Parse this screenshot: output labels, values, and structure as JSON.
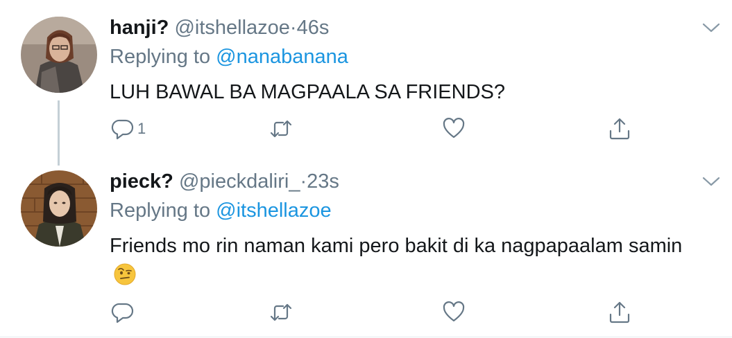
{
  "tweets": [
    {
      "name": "hanji?",
      "handle": "@itshellazoe",
      "dot": "·",
      "time": "46s",
      "replying_prefix": "Replying to",
      "replying_to": "@nanabanana",
      "text": "LUH BAWAL BA MAGPAALA SA FRIENDS?",
      "reply_count": "1"
    },
    {
      "name": "pieck?",
      "handle": "@pieckdaliri_",
      "dot": "·",
      "time": "23s",
      "replying_prefix": "Replying to",
      "replying_to": "@itshellazoe",
      "text": "Friends mo rin naman kami pero bakit di ka nagpapaalam samin",
      "emoji": "face-with-raised-eyebrow-emoji",
      "reply_count": ""
    }
  ],
  "icons": {
    "reply": "reply-icon",
    "retweet": "retweet-icon",
    "like": "heart-icon",
    "share": "share-icon",
    "menu": "chevron-down-icon"
  },
  "colors": {
    "link": "#1b95e0",
    "secondary": "#657786",
    "thread_line": "#c4cfd6"
  }
}
